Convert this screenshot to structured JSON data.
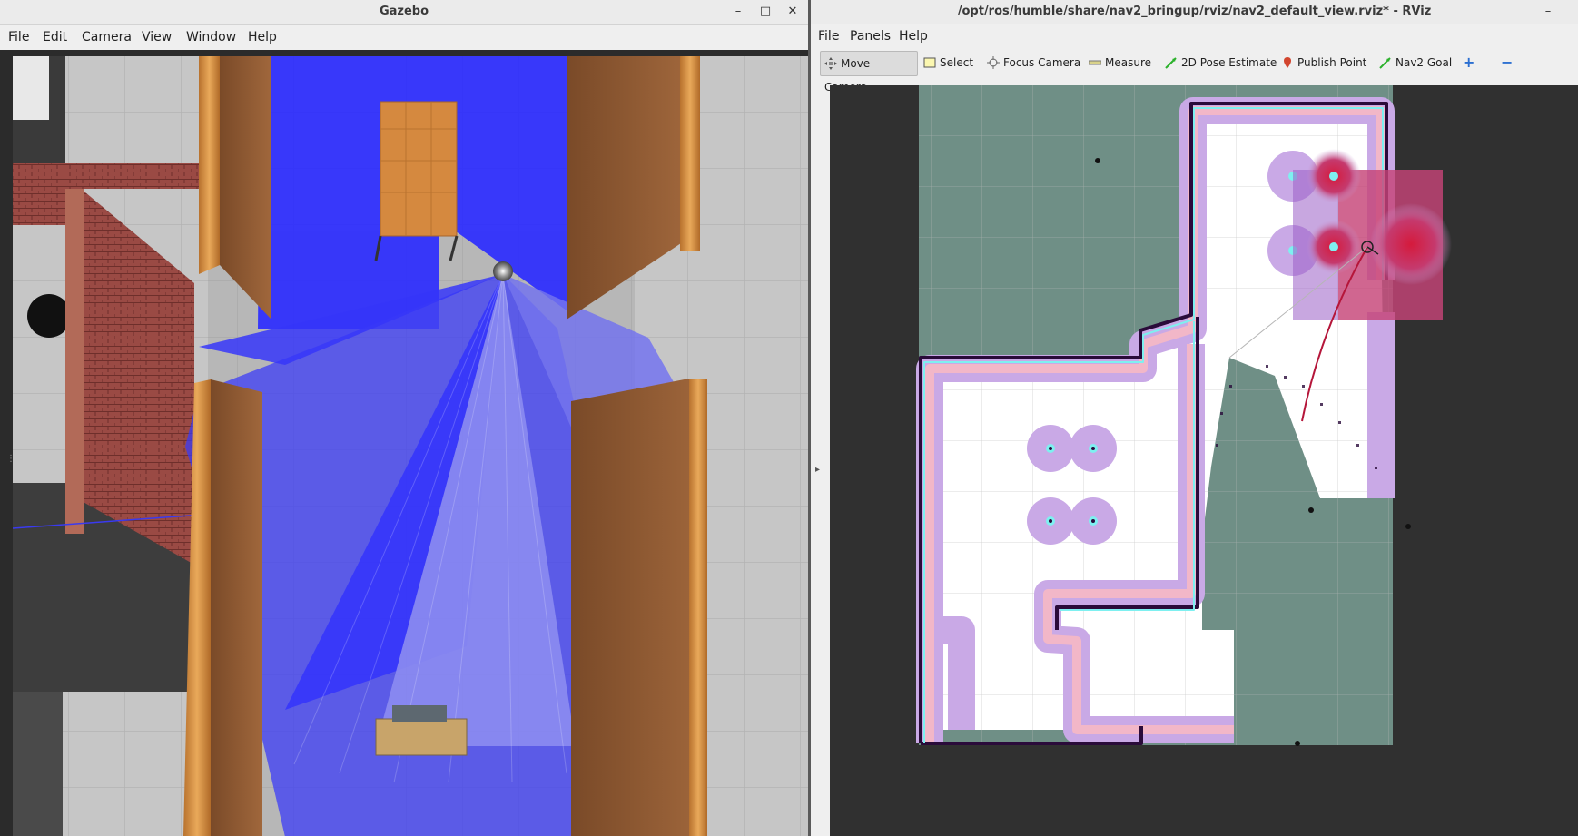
{
  "gazebo": {
    "title": "Gazebo",
    "menu": [
      "File",
      "Edit",
      "Camera",
      "View",
      "Window",
      "Help"
    ],
    "window_controls": {
      "minimize": "–",
      "maximize": "□",
      "close": "✕"
    }
  },
  "rviz": {
    "title": "/opt/ros/humble/share/nav2_bringup/rviz/nav2_default_view.rviz* - RViz",
    "menu": [
      "File",
      "Panels",
      "Help"
    ],
    "window_controls": {
      "minimize": "–"
    },
    "tools": [
      {
        "label": "Move Camera",
        "icon": "move-camera-icon",
        "active": true
      },
      {
        "label": "Select",
        "icon": "select-icon"
      },
      {
        "label": "Focus Camera",
        "icon": "focus-camera-icon"
      },
      {
        "label": "Measure",
        "icon": "ruler-icon"
      },
      {
        "label": "2D Pose Estimate",
        "icon": "pose-arrow-icon"
      },
      {
        "label": "Publish Point",
        "icon": "map-pin-icon"
      },
      {
        "label": "Nav2 Goal",
        "icon": "goal-arrow-icon"
      }
    ],
    "extra_tools": {
      "add": "+",
      "remove": "−"
    }
  },
  "colors": {
    "laser_scan": "#2b2bff",
    "costmap_inflation": "#c9a9e6",
    "costmap_lethal": "#2a0b3a",
    "costmap_inscribed": "#7ef0f0",
    "unknown_space": "#6f8f86",
    "free_space": "#ffffff",
    "local_costmap_high": "#e0304c"
  }
}
